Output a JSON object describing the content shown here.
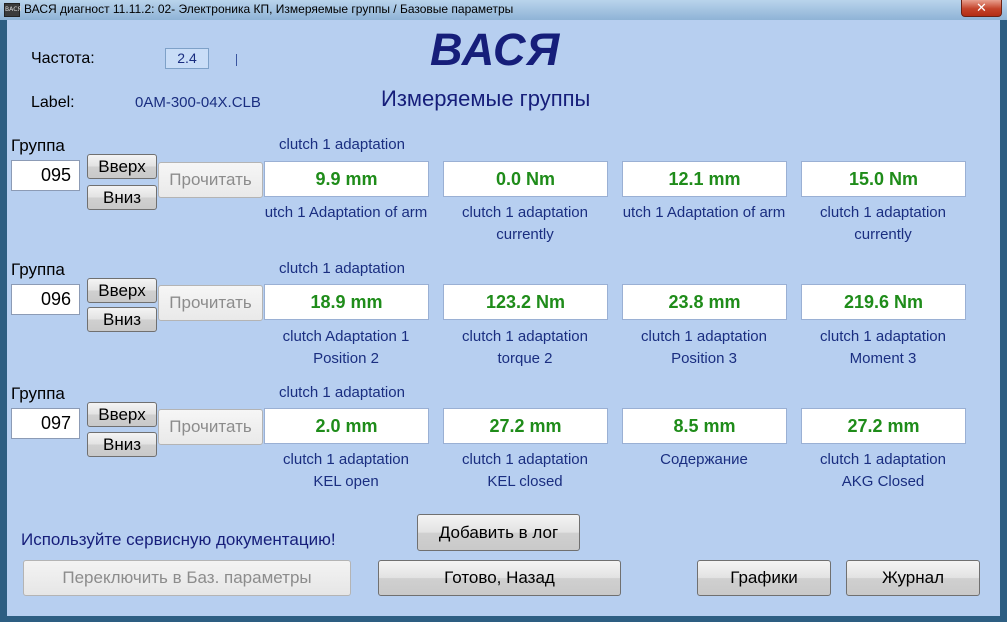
{
  "window": {
    "title": "ВАСЯ диагност 11.11.2: 02- Электроника КП,  Измеряемые группы / Базовые параметры",
    "icon_text": "ВАСЯ",
    "close_symbol": "✕"
  },
  "header": {
    "freq_label": "Частота:",
    "freq_value": "2.4",
    "label_label": "Label:",
    "label_value": "0AM-300-04X.CLB",
    "logo": "ВАСЯ",
    "mode_title": "Измеряемые группы"
  },
  "groups": [
    {
      "label": "Группа",
      "number": "095",
      "up": "Вверх",
      "down": "Вниз",
      "read": "Прочитать",
      "caption": "clutch 1 adaptation",
      "fields": [
        {
          "value": "9.9 mm",
          "desc1": "utch 1 Adaptation of arm",
          "desc2": ""
        },
        {
          "value": "0.0 Nm",
          "desc1": "clutch 1 adaptation",
          "desc2": "currently"
        },
        {
          "value": "12.1 mm",
          "desc1": "utch 1 Adaptation of arm",
          "desc2": ""
        },
        {
          "value": "15.0 Nm",
          "desc1": "clutch 1 adaptation",
          "desc2": "currently"
        }
      ]
    },
    {
      "label": "Группа",
      "number": "096",
      "up": "Вверх",
      "down": "Вниз",
      "read": "Прочитать",
      "caption": "clutch 1 adaptation",
      "fields": [
        {
          "value": "18.9 mm",
          "desc1": "clutch Adaptation 1",
          "desc2": "Position 2"
        },
        {
          "value": "123.2 Nm",
          "desc1": "clutch 1 adaptation",
          "desc2": "torque 2"
        },
        {
          "value": "23.8 mm",
          "desc1": "clutch 1 adaptation",
          "desc2": "Position 3"
        },
        {
          "value": "219.6 Nm",
          "desc1": "clutch 1 adaptation",
          "desc2": "Moment 3"
        }
      ]
    },
    {
      "label": "Группа",
      "number": "097",
      "up": "Вверх",
      "down": "Вниз",
      "read": "Прочитать",
      "caption": "clutch 1 adaptation",
      "fields": [
        {
          "value": "2.0 mm",
          "desc1": "clutch 1 adaptation",
          "desc2": "KEL open"
        },
        {
          "value": "27.2 mm",
          "desc1": "clutch 1 adaptation",
          "desc2": "KEL closed"
        },
        {
          "value": "8.5 mm",
          "desc1": "Содержание",
          "desc2": ""
        },
        {
          "value": "27.2 mm",
          "desc1": "clutch 1 adaptation",
          "desc2": "AKG Closed"
        }
      ]
    }
  ],
  "footer": {
    "hint": "Используйте сервисную документацию!",
    "add_log": "Добавить в лог",
    "switch_basic": "Переключить в Баз. параметры",
    "done_back": "Готово, Назад",
    "graphs": "Графики",
    "journal": "Журнал"
  },
  "colors": {
    "background": "#b7cff0",
    "value_text": "#1f8c1a",
    "label_text": "#1a2e80",
    "logo": "#161e7a"
  }
}
